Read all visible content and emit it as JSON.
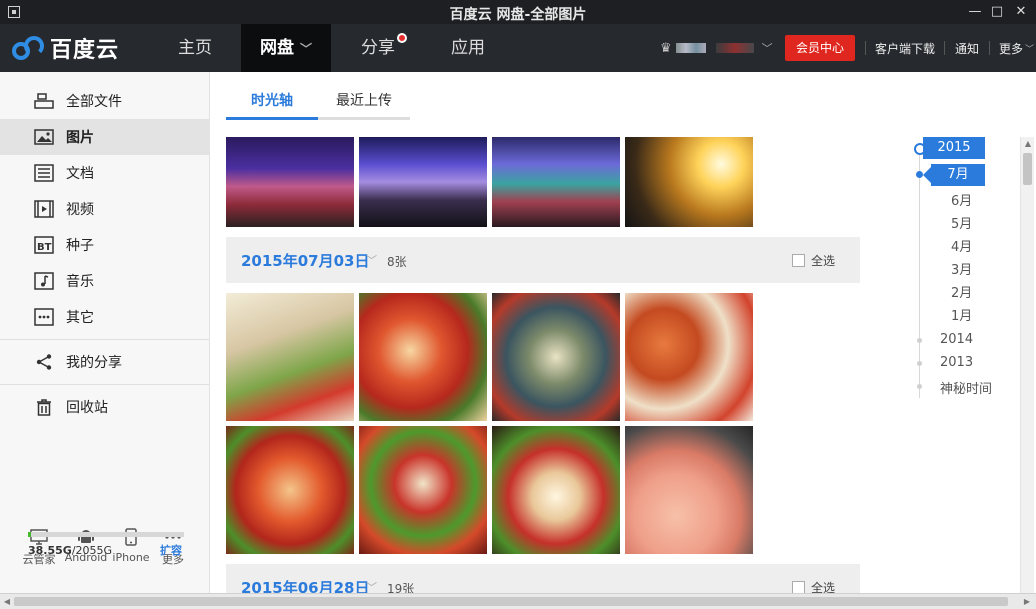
{
  "window": {
    "title": "百度云 网盘-全部图片"
  },
  "nav": {
    "logo_text": "百度云",
    "tabs": [
      {
        "label": "主页"
      },
      {
        "label": "网盘"
      },
      {
        "label": "分享"
      },
      {
        "label": "应用"
      }
    ],
    "vip_button": "会员中心",
    "links": [
      "客户端下载",
      "通知",
      "更多"
    ]
  },
  "sidebar": {
    "items": [
      {
        "label": "全部文件",
        "icon": "folder-icon"
      },
      {
        "label": "图片",
        "icon": "image-icon"
      },
      {
        "label": "文档",
        "icon": "document-icon"
      },
      {
        "label": "视频",
        "icon": "video-icon"
      },
      {
        "label": "种子",
        "icon": "torrent-icon"
      },
      {
        "label": "音乐",
        "icon": "music-icon"
      },
      {
        "label": "其它",
        "icon": "more-dots-icon"
      }
    ],
    "share": {
      "label": "我的分享",
      "icon": "share-icon"
    },
    "recycle": {
      "label": "回收站",
      "icon": "trash-icon"
    },
    "devices": [
      {
        "label": "云管家",
        "icon": "monitor-icon"
      },
      {
        "label": "Android",
        "icon": "android-icon"
      },
      {
        "label": "iPhone",
        "icon": "phone-icon"
      },
      {
        "label": "更多",
        "icon": "ellipsis-icon"
      }
    ],
    "quota": {
      "used": "38.55G",
      "total": "/2055G",
      "fraction": 0.019,
      "expand_label": "扩容"
    }
  },
  "main": {
    "tabs": [
      {
        "label": "时光轴"
      },
      {
        "label": "最近上传"
      }
    ],
    "groups": [
      {
        "date": "2015年07月03日",
        "count": "8张",
        "select_all": "全选"
      },
      {
        "date": "2015年06月28日",
        "count": "19张",
        "select_all": "全选"
      }
    ]
  },
  "timeline": {
    "active_year": "2015",
    "active_month": "7月",
    "months": [
      "6月",
      "5月",
      "4月",
      "3月",
      "2月",
      "1月"
    ],
    "years": [
      "2014",
      "2013",
      "神秘时间"
    ]
  },
  "colors": {
    "accent": "#2b7bdc",
    "vip": "#e0271f",
    "nav_bg": "#26292e"
  }
}
